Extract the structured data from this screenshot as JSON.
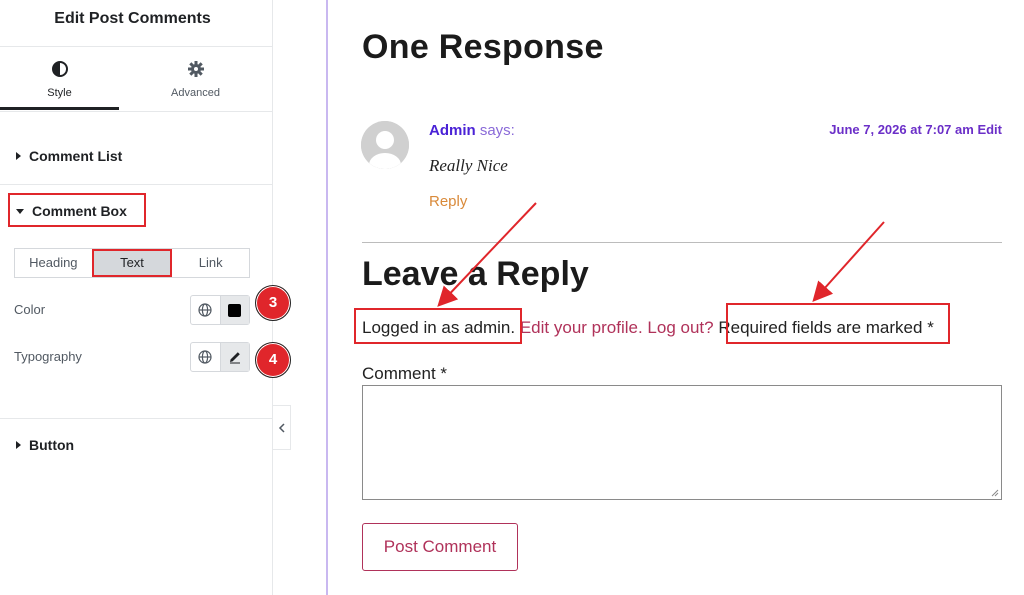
{
  "panel": {
    "title": "Edit Post Comments",
    "tabs": [
      {
        "label": "Style",
        "icon": "contrast-icon",
        "active": true
      },
      {
        "label": "Advanced",
        "icon": "gear-icon",
        "active": false
      }
    ],
    "sections": {
      "comment_list": "Comment List",
      "comment_box": "Comment Box",
      "button": "Button"
    },
    "segments": [
      "Heading",
      "Text",
      "Link"
    ],
    "active_segment": "Text",
    "controls": {
      "color_label": "Color",
      "typography_label": "Typography"
    },
    "badges": [
      "3",
      "4"
    ]
  },
  "preview": {
    "heading_response": "One Response",
    "comment": {
      "author": "Admin",
      "says": "says:",
      "date": "June 7, 2026 at 7:07 am",
      "edit": "Edit",
      "text": "Really Nice",
      "reply": "Reply"
    },
    "heading_leave": "Leave a Reply",
    "logged_in": "Logged in as admin.",
    "edit_profile": "Edit your profile.",
    "log_out": "Log out?",
    "required": "Required fields are marked",
    "required_star": "*",
    "comment_label": "Comment *",
    "post_button": "Post Comment"
  },
  "colors": {
    "highlight": "#e0262b",
    "author": "#4a22d6",
    "date": "#6b2fc8",
    "link": "#b0325a",
    "reply": "#d98a3a",
    "divider": "#c9b8f0"
  }
}
